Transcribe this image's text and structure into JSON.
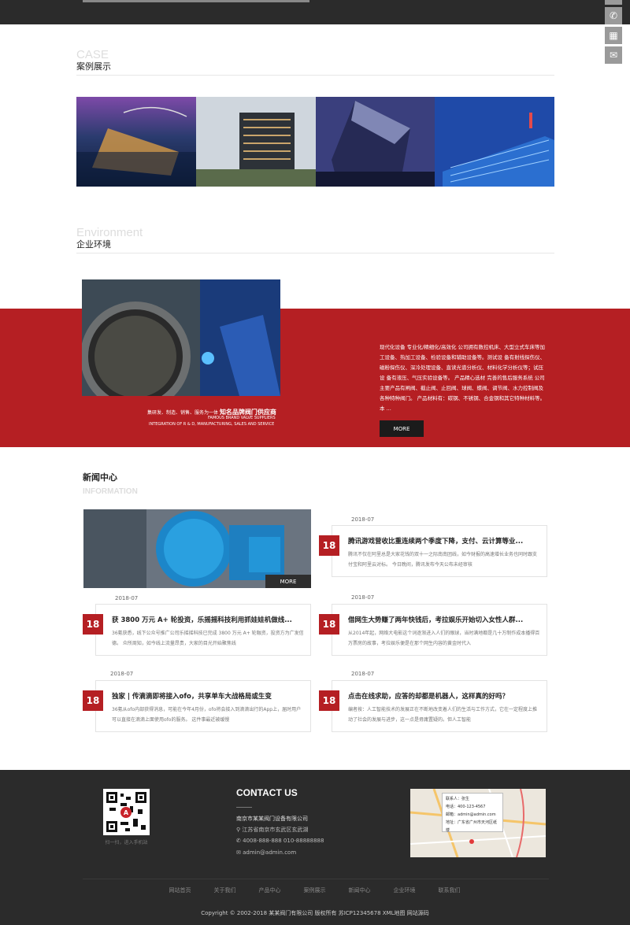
{
  "side_tools": {
    "icons": [
      "user-icon",
      "phone-icon",
      "qrcode-icon",
      "mail-icon"
    ]
  },
  "case": {
    "en": "CASE",
    "cn": "案例展示"
  },
  "environment": {
    "en": "Environment",
    "cn": "企业环境",
    "tagline_cn": "集研发、制造、销售、服务为一体",
    "tagline_big": "知名品牌阀门供应商",
    "tagline_en1": "FAMOUS BRAND VALVE SUPPLIERS",
    "tagline_en2": "INTEGRATION OF R & D, MANUFACTURING, SALES AND SERVICE",
    "description": "现代化设备 专业化/精细化/高效化 公司拥有数控机床、大型立式车床等加工设备、热加工设备、检验设备和辅助设备等。测试设 备有射线探伤仪、磁粉探伤仪、深冷处理设备、直读光谱分析仪、材料化学分析仪等；试压设 备有液压、气压实验设备等。 产品精心选材 完善的售后服务系统 公司主要产品有闸阀、截止阀、止回阀、球阀、蝶阀、调节阀、水力控制阀及各种特种阀门。 产品材料有：碳钢、不锈钢、合金钢和其它特种材料等。本 ...",
    "more": "MORE"
  },
  "news": {
    "title": "新闻中心",
    "en": "INFORMATION",
    "feature_more": "MORE",
    "items": [
      {
        "date": "2018-07",
        "day": "18",
        "title": "腾讯游戏营收比重连续两个季度下降，支付、云计算等业...",
        "excerpt": "腾讯不仅在阿里总是大家花钱的双十一之际南南团线，如今财报的高速增长业务也同时跟支付宝和阿里云对标。 今日晚间，腾讯发布今天公布未经审核"
      },
      {
        "date": "2018-07",
        "day": "18",
        "title": "获 3800 万元 A+ 轮投资，乐摇摇科技利用抓娃娃机做线...",
        "excerpt": "36氪获悉，线下公众号推广公司乐摇摇科技已完成 3800 万元 A+ 轮融资，投资方为广发信德。 众所周知，如今线上流量昂贵，大家的目光开始聚焦线"
      },
      {
        "date": "2018-07",
        "day": "18",
        "title": "借网生大势赚了两年快钱后，考拉娱乐开始切入女性人群...",
        "excerpt": "从2014年起，网络大电影这个词逐渐进入人们的眼球，当时满地都是几十万制作成本播得百万票房的故事，考拉娱乐便是在那个网生内容的黄金时代入"
      },
      {
        "date": "2018-07",
        "day": "18",
        "title": "独家 | 传滴滴即将接入ofo，共享单车大战格局或生变",
        "excerpt": "36氪从ofo内部获得消息，可能在今年4月份，ofo将会接入到滴滴出行的App上，届时用户可以直接在滴滴上面使用ofo的服务。 这件事最近被缓慢"
      },
      {
        "date": "2018-07",
        "day": "18",
        "title": "点击在线求助，应答的却都是机器人，这样真的好吗？",
        "excerpt": "编者按：人工智能技术的发展正在不断地改变着人们的生活与工作方式，它在一定程度上推动了社会的发展与进步，这一点是毋庸置疑的。但人工智能"
      }
    ]
  },
  "footer": {
    "qr_caption": "扫一扫，进入手机站",
    "contact_title": "CONTACT US",
    "company": "南京市某某阀门设备有限公司",
    "address": "江苏省南京市玄武区玄武湖",
    "phone": "4008-888-888    010-88888888",
    "email": "admin@admin.com",
    "map_popup": {
      "contact": "联系人：张生",
      "tel": "电话：400-123-4567",
      "mail": "邮箱：admin@admin.com",
      "addr": "地址：广东省广州市天河区纸楼"
    },
    "nav": [
      "网站首页",
      "关于我们",
      "产品中心",
      "案例展示",
      "新闻中心",
      "企业环境",
      "联系我们"
    ],
    "copyright": "Copyright © 2002-2018 某某阀门有限公司 版权所有  苏ICP12345678  XML地图  网站源码"
  },
  "colors": {
    "brand_red": "#b51f23",
    "dark": "#2b2b2b"
  }
}
